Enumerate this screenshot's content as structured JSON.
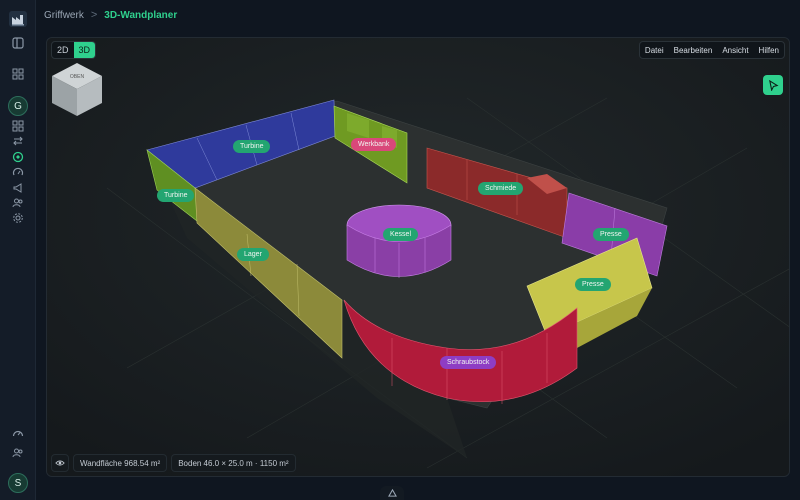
{
  "breadcrumb": {
    "parent": "Griffwerk",
    "separator": ">",
    "current": "3D-Wandplaner"
  },
  "sidebar": {
    "logo": "factory-logo-icon",
    "avatar_top": "G",
    "avatar_bottom": "S",
    "icons": [
      "panel-icon",
      "grid-icon",
      "layers-icon",
      "flow-icon",
      "cube-icon",
      "gauge-icon",
      "megaphone-icon",
      "users-icon",
      "settings-icon",
      "speedometer-icon",
      "team-icon"
    ]
  },
  "view_toggle": {
    "option_2d": "2D",
    "option_3d": "3D",
    "active": "3D"
  },
  "menu": {
    "file": "Datei",
    "edit": "Bearbeiten",
    "view": "Ansicht",
    "help": "Hilfen"
  },
  "tool": {
    "icon": "cursor-arrow-icon"
  },
  "walls": {
    "turbine_back": "Turbine",
    "turbine_left": "Turbine",
    "werkbank": "Werkbank",
    "schmiede": "Schmiede",
    "kessel": "Kessel",
    "lager": "Lager",
    "presse_back": "Presse",
    "presse_front": "Presse",
    "schraubstock": "Schraubstock"
  },
  "colors": {
    "accent": "#2fd08d",
    "turbine": "#2f3a9c",
    "werkbank": "#6f9a22",
    "schmiede": "#8b2a2a",
    "presse": "#8a3da8",
    "presse_yellow": "#c7c64b",
    "schraubstock": "#b11b3a",
    "lager": "#8c8a3a",
    "kessel": "#8a3fa6"
  },
  "stats": {
    "wall_area": "Wandfläche 968.54 m²",
    "floor": "Boden 46.0 × 25.0 m · 1150 m²"
  }
}
